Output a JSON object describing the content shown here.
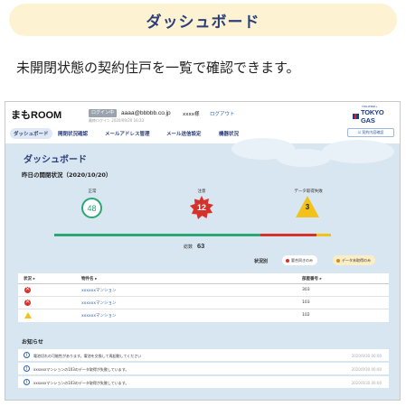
{
  "banner": {
    "title": "ダッシュボード"
  },
  "description": "未開閉状態の契約住戸を一覧で確認できます。",
  "header": {
    "logo": "まもROOM",
    "login_badge": "ログイン中",
    "login_sub": "最終ログイン 2020/09/20 16:33",
    "email": "aaaa@bbbbb.co.jp",
    "user_name": "xxxx様",
    "logout": "ログアウト",
    "brand_name": "TOKYO GAS",
    "brand_sub": "CHALLENGE+"
  },
  "nav": {
    "items": [
      "ダッシュボード",
      "開閉状況確認",
      "メールアドレス管理",
      "メール送信設定",
      "機器状況"
    ],
    "exit": "☑ 契約内容確認"
  },
  "dashboard": {
    "title": "ダッシュボード",
    "subtitle": "昨日の開閉状況（2020/10/20）",
    "stats": {
      "normal_label": "正常",
      "normal_value": "48",
      "caution_label": "注意",
      "caution_value": "12",
      "fail_label": "データ取得失敗",
      "fail_value": "3"
    },
    "total_label": "総数",
    "total_value": "63",
    "legend_label": "状況別",
    "legend_pills": [
      "要合同きのみ",
      "データ未取得のみ"
    ]
  },
  "table": {
    "headers": [
      "状況 ▸",
      "物件名 ▸",
      "部屋番号 ▸"
    ],
    "rows": [
      {
        "status": "error",
        "name": "xxxxxxマンション",
        "room": "303"
      },
      {
        "status": "error",
        "name": "xxxxxxマンション",
        "room": "103"
      },
      {
        "status": "warning",
        "name": "xxxxxxマンション",
        "room": "102"
      }
    ]
  },
  "news": {
    "title": "お知らせ",
    "items": [
      {
        "text": "電池切れの可能性があります。電池を交換して再起動してください",
        "date": "2020/9/30 00:00"
      },
      {
        "text": "xxxxxxマンションの103のデータ取得が失敗しています。",
        "date": "2020/9/30 00:00"
      },
      {
        "text": "xxxxxxマンションの103のデータ取得が失敗しています。",
        "date": "2020/9/30 00:00"
      }
    ]
  },
  "colors": {
    "normal": "#2aa772",
    "caution": "#d6312a",
    "fail": "#f2c21b",
    "navy": "#2c3f7a"
  }
}
